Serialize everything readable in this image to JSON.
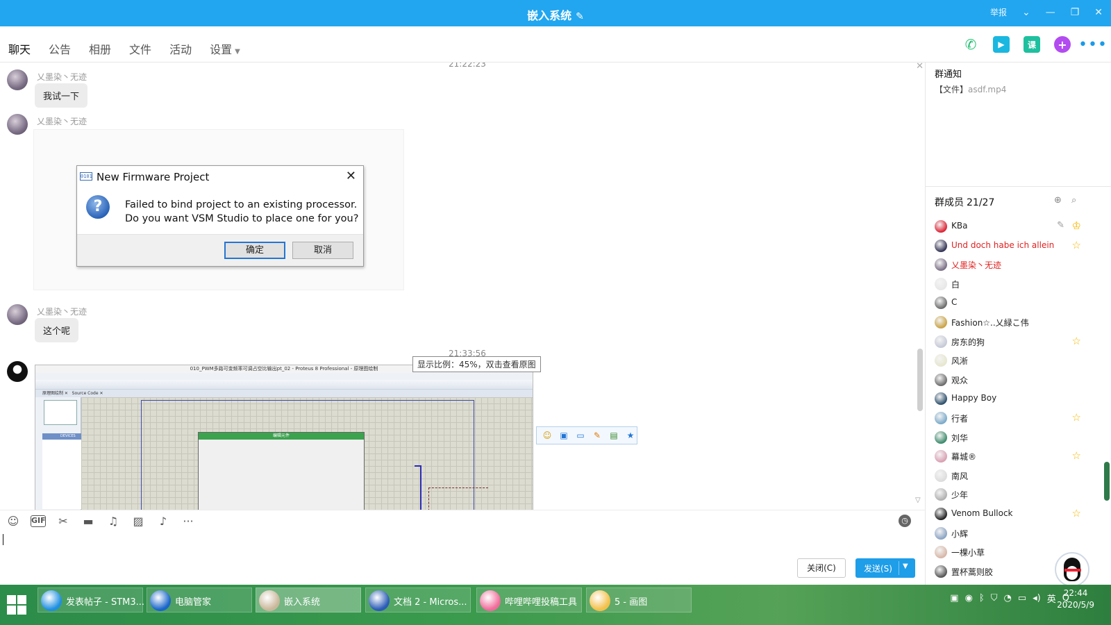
{
  "window": {
    "title": "嵌入系统",
    "report": "举报"
  },
  "nav": {
    "tabs": [
      "聊天",
      "公告",
      "相册",
      "文件",
      "活动",
      "设置"
    ]
  },
  "chat": {
    "timestamps": [
      "21:22:23",
      "21:33:56"
    ],
    "messages": [
      {
        "sender": "乂墨染丶无迹",
        "text": "我试一下"
      },
      {
        "sender": "乂墨染丶无迹",
        "text": ""
      },
      {
        "sender": "乂墨染丶无迹",
        "text": "这个呢"
      }
    ]
  },
  "dialog": {
    "title": "New Firmware Project",
    "app_icon_text": "0101",
    "message_line1": "Failed to bind project to an existing processor.",
    "message_line2": "Do you want VSM Studio to place one for you?",
    "ok_label": "确定",
    "cancel_label": "取消"
  },
  "screenshot": {
    "window_title": "010_PWM多路可变频率可调占空比输出pt_02 - Proteus 8 Professional - 原理图绘制",
    "tab1": "原理图绘制",
    "tab2": "Source Code",
    "devices_label": "DEVICES",
    "dialog_title": "编辑元件"
  },
  "tooltip": "显示比例：45%，双击查看原图",
  "input": {
    "close_label": "关闭(C)",
    "send_label": "发送(S)"
  },
  "right_panel": {
    "notice_title": "群通知",
    "notice_file_prefix": "【文件】",
    "notice_file_name": "asdf.mp4",
    "members_title": "群成员",
    "members_count": "21/27",
    "members": [
      {
        "name": "KBa",
        "red": false,
        "star": false,
        "color": "#d23"
      },
      {
        "name": "Und doch habe ich allein",
        "red": true,
        "star": true,
        "color": "#335"
      },
      {
        "name": "乂墨染丶无迹",
        "red": true,
        "star": false,
        "color": "#7b6f86"
      },
      {
        "name": "白",
        "red": false,
        "star": false,
        "color": "#e7e7e7"
      },
      {
        "name": "C",
        "red": false,
        "star": false,
        "color": "#6a6a6a"
      },
      {
        "name": "Fashion☆..乂緑こ伟",
        "red": false,
        "star": false,
        "color": "#c9a244"
      },
      {
        "name": "房东的狗",
        "red": false,
        "star": true,
        "color": "#c5c9d6"
      },
      {
        "name": "风淅",
        "red": false,
        "star": false,
        "color": "#e6e6cf"
      },
      {
        "name": "观众",
        "red": false,
        "star": false,
        "color": "#6b6b6b"
      },
      {
        "name": "Happy Boy",
        "red": false,
        "star": false,
        "color": "#2d4f6b"
      },
      {
        "name": "行者",
        "red": false,
        "star": true,
        "color": "#7aa9c9"
      },
      {
        "name": "刘华",
        "red": false,
        "star": false,
        "color": "#3b8a6c"
      },
      {
        "name": "幕城®",
        "red": false,
        "star": true,
        "color": "#d9a0b2"
      },
      {
        "name": "南风",
        "red": false,
        "star": false,
        "color": "#dcdcdc"
      },
      {
        "name": "少年",
        "red": false,
        "star": false,
        "color": "#b0b0b0"
      },
      {
        "name": "Venom Bullock",
        "red": false,
        "star": true,
        "color": "#222"
      },
      {
        "name": "小辉",
        "red": false,
        "star": false,
        "color": "#8aa3c3"
      },
      {
        "name": "一棵小草",
        "red": false,
        "star": false,
        "color": "#d6b6a6"
      },
      {
        "name": "置杯蒿则胶",
        "red": false,
        "star": false,
        "color": "#555"
      }
    ]
  },
  "taskbar": {
    "tasks": [
      {
        "label": "发表帖子 - STM3...",
        "color": "#1f8fe0"
      },
      {
        "label": "电脑管家",
        "color": "#1a66c9"
      },
      {
        "label": "嵌入系统",
        "color": "#c9b79a"
      },
      {
        "label": "文档 2 - Micros...",
        "color": "#2b5cb6"
      },
      {
        "label": "哔哩哔哩投稿工具",
        "color": "#f06b9a"
      },
      {
        "label": "5 - 画图",
        "color": "#f3c04a"
      }
    ],
    "tray_lang": "英",
    "time": "22:44",
    "date": "2020/5/9"
  }
}
